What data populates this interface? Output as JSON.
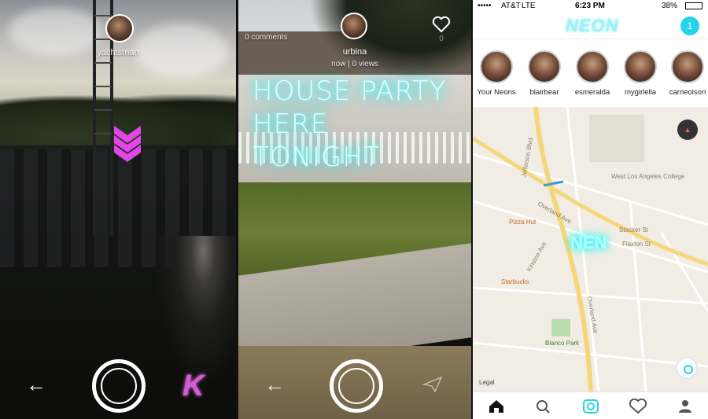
{
  "panel1": {
    "username": "yachtsman",
    "back_icon": "arrow-left-icon",
    "shutter_icon": "shutter-icon",
    "brand_icon_text": "K",
    "chevron_color": "#e146e6"
  },
  "panel2": {
    "comments": "0 comments",
    "username": "urbina",
    "meta": "now | 0 views",
    "neon_line1": "HOUSE PARTY",
    "neon_line2": "HERE TONIGHT",
    "like_icon": "heart-icon",
    "back_icon": "arrow-left-icon",
    "send_icon": "send-icon"
  },
  "panel3": {
    "status": {
      "carrier": "AT&T",
      "network": "LTE",
      "time": "6:23 PM",
      "battery": "38%"
    },
    "logo": "NEON",
    "notification_count": "1",
    "stories": [
      {
        "name": "Your Neons"
      },
      {
        "name": "blairbear"
      },
      {
        "name": "esmeralda"
      },
      {
        "name": "mygirlella"
      },
      {
        "name": "carrieolson"
      }
    ],
    "map_labels": {
      "college": "West Los Angeles College",
      "pizza": "Pizza Hut",
      "starbucks": "Starbucks",
      "park": "Blanco Park",
      "jefferson": "Jefferson Blvd",
      "overland": "Overland Ave",
      "stocker": "Stocker St",
      "flaxton": "Flaxton St",
      "kinston": "Kinston Ave",
      "overland2": "Overland Ave",
      "legal": "Legal",
      "marker": "NEN"
    },
    "tabs": [
      "home-icon",
      "search-icon",
      "camera-icon",
      "heart-icon",
      "profile-icon"
    ],
    "accent": "#27d3e8"
  }
}
